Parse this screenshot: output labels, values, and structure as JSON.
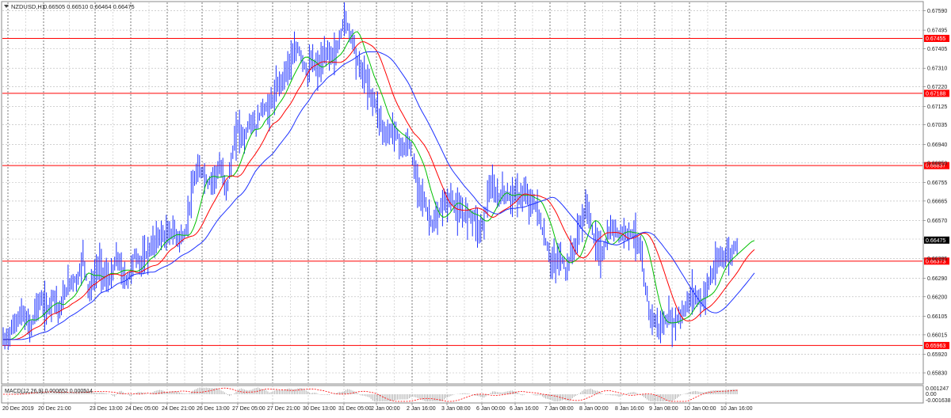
{
  "header": {
    "symbol_label": "NZDUSD,H1",
    "ohlc_label": "0.66505 0.66510 0.66464 0.66475"
  },
  "price_axis": {
    "ticks": [
      "0.67590",
      "0.67495",
      "0.67405",
      "0.67310",
      "0.67220",
      "0.67125",
      "0.67035",
      "0.66940",
      "0.66850",
      "0.66755",
      "0.66665",
      "0.66570",
      "0.66480",
      "0.66385",
      "0.66290",
      "0.66200",
      "0.66105",
      "0.66015",
      "0.65920",
      "0.65830"
    ],
    "current_price": "0.66475"
  },
  "horizontal_levels": [
    {
      "label": "0.67455",
      "value": 0.67455
    },
    {
      "label": "0.67188",
      "value": 0.67188
    },
    {
      "label": "0.66837",
      "value": 0.66837
    },
    {
      "label": "0.66373",
      "value": 0.66373
    },
    {
      "label": "0.65963",
      "value": 0.65963
    }
  ],
  "time_axis": {
    "labels": [
      "20 Dec 2019",
      "20 Dec 21:00",
      "23 Dec 13:00",
      "24 Dec 05:00",
      "24 Dec 21:00",
      "26 Dec 13:00",
      "27 Dec 05:00",
      "27 Dec 21:00",
      "30 Dec 13:00",
      "31 Dec 05:00",
      "2 Jan 00:00",
      "2 Jan 16:00",
      "3 Jan 08:00",
      "6 Jan 00:00",
      "6 Jan 16:00",
      "7 Jan 08:00",
      "8 Jan 00:00",
      "8 Jan 16:00",
      "9 Jan 08:00",
      "10 Jan 00:00",
      "10 Jan 16:00"
    ]
  },
  "macd": {
    "label": "MACD(12,26,9) 0.000652 0.000514",
    "ticks": [
      "0.001247",
      "0.00",
      "-0.001638"
    ]
  },
  "colors": {
    "level_line": "#ff0000",
    "candles": "#1e32ff",
    "ma_fast": "#00c000",
    "ma_mid": "#ff0000",
    "ma_slow": "#1e32ff",
    "grid": "#b4b4b4",
    "macd_signal": "#ff0000",
    "macd_hist": "#a0a0a0"
  },
  "chart_data": {
    "type": "line",
    "title": "NZDUSD,H1",
    "ylim": [
      0.6578,
      0.6763
    ],
    "price_series": [
      [
        0,
        0.6604
      ],
      [
        5,
        0.6598
      ],
      [
        12,
        0.6602
      ],
      [
        20,
        0.6608
      ],
      [
        28,
        0.6612
      ],
      [
        35,
        0.6607
      ],
      [
        40,
        0.6605
      ],
      [
        45,
        0.6615
      ],
      [
        52,
        0.6618
      ],
      [
        60,
        0.6613
      ],
      [
        68,
        0.6622
      ],
      [
        75,
        0.6612
      ],
      [
        82,
        0.6622
      ],
      [
        90,
        0.6628
      ],
      [
        98,
        0.6628
      ],
      [
        105,
        0.664
      ],
      [
        112,
        0.6622
      ],
      [
        118,
        0.6628
      ],
      [
        125,
        0.6636
      ],
      [
        132,
        0.663
      ],
      [
        140,
        0.6628
      ],
      [
        148,
        0.664
      ],
      [
        155,
        0.663
      ],
      [
        162,
        0.6628
      ],
      [
        170,
        0.664
      ],
      [
        178,
        0.6636
      ],
      [
        186,
        0.6641
      ],
      [
        194,
        0.6646
      ],
      [
        202,
        0.665
      ],
      [
        210,
        0.6649
      ],
      [
        218,
        0.6652
      ],
      [
        226,
        0.6648
      ],
      [
        234,
        0.665
      ],
      [
        240,
        0.6667
      ],
      [
        248,
        0.668
      ],
      [
        256,
        0.6681
      ],
      [
        262,
        0.6675
      ],
      [
        270,
        0.6678
      ],
      [
        278,
        0.6683
      ],
      [
        286,
        0.6672
      ],
      [
        294,
        0.669
      ],
      [
        300,
        0.6703
      ],
      [
        308,
        0.6696
      ],
      [
        316,
        0.6706
      ],
      [
        324,
        0.6702
      ],
      [
        330,
        0.6712
      ],
      [
        338,
        0.6711
      ],
      [
        344,
        0.6715
      ],
      [
        350,
        0.6722
      ],
      [
        358,
        0.6727
      ],
      [
        364,
        0.6733
      ],
      [
        370,
        0.6736
      ],
      [
        376,
        0.6741
      ],
      [
        382,
        0.6735
      ],
      [
        388,
        0.6728
      ],
      [
        394,
        0.6735
      ],
      [
        400,
        0.673
      ],
      [
        408,
        0.6735
      ],
      [
        414,
        0.6739
      ],
      [
        420,
        0.6737
      ],
      [
        426,
        0.674
      ],
      [
        430,
        0.6748
      ],
      [
        434,
        0.6755
      ],
      [
        438,
        0.6752
      ],
      [
        442,
        0.6748
      ],
      [
        446,
        0.6745
      ],
      [
        450,
        0.6735
      ],
      [
        456,
        0.673
      ],
      [
        462,
        0.6726
      ],
      [
        468,
        0.6718
      ],
      [
        474,
        0.6714
      ],
      [
        480,
        0.6706
      ],
      [
        486,
        0.6698
      ],
      [
        492,
        0.67
      ],
      [
        498,
        0.6702
      ],
      [
        504,
        0.6695
      ],
      [
        510,
        0.6691
      ],
      [
        516,
        0.6696
      ],
      [
        522,
        0.6683
      ],
      [
        528,
        0.6675
      ],
      [
        534,
        0.6668
      ],
      [
        540,
        0.666
      ],
      [
        546,
        0.6655
      ],
      [
        552,
        0.6657
      ],
      [
        558,
        0.6665
      ],
      [
        564,
        0.6666
      ],
      [
        570,
        0.6668
      ],
      [
        576,
        0.6662
      ],
      [
        582,
        0.666
      ],
      [
        588,
        0.666
      ],
      [
        594,
        0.666
      ],
      [
        600,
        0.6658
      ],
      [
        606,
        0.6651
      ],
      [
        612,
        0.666
      ],
      [
        618,
        0.6674
      ],
      [
        624,
        0.667
      ],
      [
        630,
        0.6668
      ],
      [
        636,
        0.6671
      ],
      [
        642,
        0.6668
      ],
      [
        648,
        0.6671
      ],
      [
        654,
        0.6668
      ],
      [
        660,
        0.667
      ],
      [
        666,
        0.6668
      ],
      [
        672,
        0.6665
      ],
      [
        678,
        0.6664
      ],
      [
        684,
        0.6652
      ],
      [
        690,
        0.6645
      ],
      [
        696,
        0.6636
      ],
      [
        702,
        0.6637
      ],
      [
        708,
        0.664
      ],
      [
        714,
        0.6632
      ],
      [
        720,
        0.664
      ],
      [
        726,
        0.6645
      ],
      [
        732,
        0.6655
      ],
      [
        738,
        0.666
      ],
      [
        742,
        0.6665
      ],
      [
        748,
        0.665
      ],
      [
        754,
        0.6645
      ],
      [
        760,
        0.664
      ],
      [
        766,
        0.6648
      ],
      [
        772,
        0.6653
      ],
      [
        778,
        0.6652
      ],
      [
        784,
        0.665
      ],
      [
        790,
        0.6652
      ],
      [
        796,
        0.6651
      ],
      [
        802,
        0.665
      ],
      [
        808,
        0.6642
      ],
      [
        814,
        0.6625
      ],
      [
        820,
        0.6612
      ],
      [
        826,
        0.6608
      ],
      [
        832,
        0.6605
      ],
      [
        838,
        0.6607
      ],
      [
        844,
        0.661
      ],
      [
        850,
        0.6607
      ],
      [
        856,
        0.661
      ],
      [
        862,
        0.6612
      ],
      [
        868,
        0.6617
      ],
      [
        874,
        0.6622
      ],
      [
        880,
        0.662
      ],
      [
        886,
        0.6617
      ],
      [
        892,
        0.6625
      ],
      [
        898,
        0.663
      ],
      [
        904,
        0.6635
      ],
      [
        910,
        0.664
      ],
      [
        916,
        0.664
      ],
      [
        922,
        0.664
      ],
      [
        928,
        0.6645
      ],
      [
        932,
        0.66475
      ]
    ]
  }
}
